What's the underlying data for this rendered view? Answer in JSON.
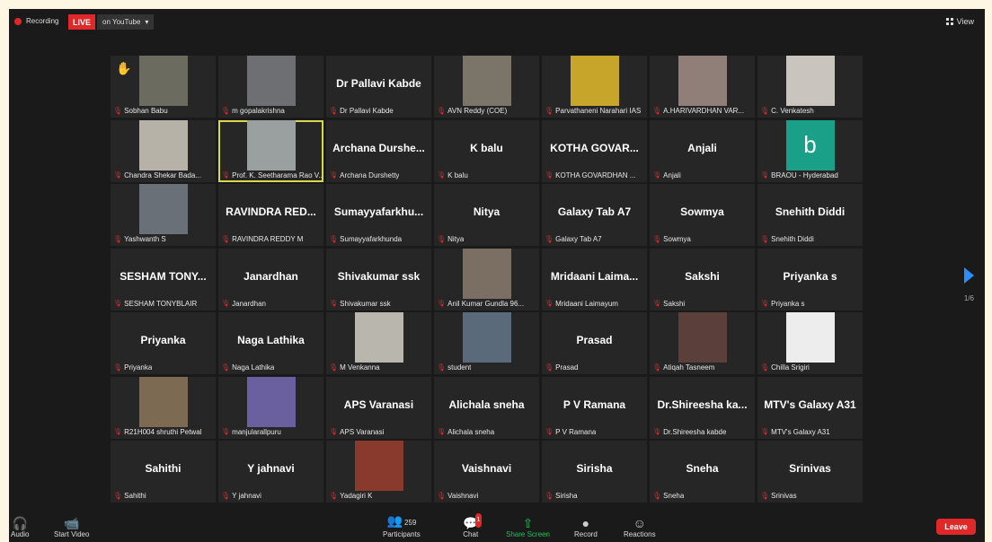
{
  "topbar": {
    "recording_label": "Recording",
    "live_label": "LIVE",
    "stream_label": "on YouTube",
    "view_label": "View"
  },
  "page_indicator": "1/6",
  "participants": [
    {
      "display": "",
      "label": "Sobhan Babu",
      "photo": "#6b6b60",
      "hand": true
    },
    {
      "display": "",
      "label": "m gopalakrishna",
      "photo": "#6e6f72"
    },
    {
      "display": "Dr Pallavi Kabde",
      "label": "Dr Pallavi Kabde"
    },
    {
      "display": "",
      "label": "AVN Reddy (COE)",
      "photo": "#7a7568"
    },
    {
      "display": "",
      "label": "Parvathaneni Narahari IAS",
      "photo": "#c6a52a"
    },
    {
      "display": "",
      "label": "A.HARIVARDHAN VAR...",
      "photo": "#8f7f78"
    },
    {
      "display": "",
      "label": "C. Venkatesh",
      "photo": "#c9c5be"
    },
    {
      "display": "",
      "label": "Chandra Shekar Bada...",
      "photo": "#b7b2a8"
    },
    {
      "display": "",
      "label": "Prof. K. Seetharama Rao V...",
      "photo": "#9aa0a0",
      "active": true
    },
    {
      "display": "Archana Durshe...",
      "label": "Archana Durshetty"
    },
    {
      "display": "K balu",
      "label": "K balu"
    },
    {
      "display": "KOTHA GOVAR...",
      "label": "KOTHA GOVARDHAN ..."
    },
    {
      "display": "Anjali",
      "label": "Anjali"
    },
    {
      "display": "",
      "label": "BRAOU - Hyderabad",
      "avatar": "b"
    },
    {
      "display": "",
      "label": "Yashwanth S",
      "photo": "#6a7078"
    },
    {
      "display": "RAVINDRA RED...",
      "label": "RAVINDRA REDDY M"
    },
    {
      "display": "Sumayyafarkhu...",
      "label": "Sumayyafarkhunda"
    },
    {
      "display": "Nitya",
      "label": "Nitya"
    },
    {
      "display": "Galaxy Tab A7",
      "label": "Galaxy Tab A7"
    },
    {
      "display": "Sowmya",
      "label": "Sowmya"
    },
    {
      "display": "Snehith Diddi",
      "label": "Snehith Diddi"
    },
    {
      "display": "SESHAM TONY...",
      "label": "SESHAM TONYBLAIR"
    },
    {
      "display": "Janardhan",
      "label": "Janardhan"
    },
    {
      "display": "Shivakumar ssk",
      "label": "Shivakumar ssk"
    },
    {
      "display": "",
      "label": "Anil Kumar Gundla 96...",
      "photo": "#7b6e62"
    },
    {
      "display": "Mridaani Laima...",
      "label": "Mridaani Laimayum"
    },
    {
      "display": "Sakshi",
      "label": "Sakshi"
    },
    {
      "display": "Priyanka s",
      "label": "Priyanka s"
    },
    {
      "display": "Priyanka",
      "label": "Priyanka"
    },
    {
      "display": "Naga Lathika",
      "label": "Naga Lathika"
    },
    {
      "display": "",
      "label": "M Venkanna",
      "photo": "#b9b6ad"
    },
    {
      "display": "",
      "label": "student",
      "photo": "#5b6a7a"
    },
    {
      "display": "Prasad",
      "label": "Prasad"
    },
    {
      "display": "",
      "label": "Atiqah Tasneem",
      "photo": "#5a3f3a"
    },
    {
      "display": "",
      "label": "Chilla Srigiri",
      "photo": "#ededed"
    },
    {
      "display": "",
      "label": "R21H004 shruthi Petwal",
      "photo": "#7d6a52"
    },
    {
      "display": "",
      "label": "manjularallpuru",
      "photo": "#6a60a0"
    },
    {
      "display": "APS Varanasi",
      "label": "APS Varanasi"
    },
    {
      "display": "Alichala sneha",
      "label": "Alichala sneha"
    },
    {
      "display": "P V Ramana",
      "label": "P V Ramana"
    },
    {
      "display": "Dr.Shireesha ka...",
      "label": "Dr.Shireesha kabde"
    },
    {
      "display": "MTV's Galaxy A31",
      "label": "MTV's Galaxy A31"
    },
    {
      "display": "Sahithi",
      "label": "Sahithi"
    },
    {
      "display": "Y jahnavi",
      "label": "Y jahnavi"
    },
    {
      "display": "",
      "label": "Yadagiri K",
      "photo": "#8a3a2c"
    },
    {
      "display": "Vaishnavi",
      "label": "Vaishnavi"
    },
    {
      "display": "Sirisha",
      "label": "Sirisha"
    },
    {
      "display": "Sneha",
      "label": "Sneha"
    },
    {
      "display": "Srinivas",
      "label": "Srinivas"
    }
  ],
  "toolbar": {
    "audio": "Audio",
    "start_video": "Start Video",
    "participants": "Participants",
    "participants_count": "259",
    "chat": "Chat",
    "chat_badge": "1",
    "share_screen": "Share Screen",
    "record": "Record",
    "reactions": "Reactions",
    "leave": "Leave"
  },
  "colors": {
    "live_red": "#e02828",
    "active_border": "#d8d84a",
    "share_green": "#1ec15b",
    "next_arrow": "#2d8cff",
    "avatar_teal": "#1aa089"
  }
}
